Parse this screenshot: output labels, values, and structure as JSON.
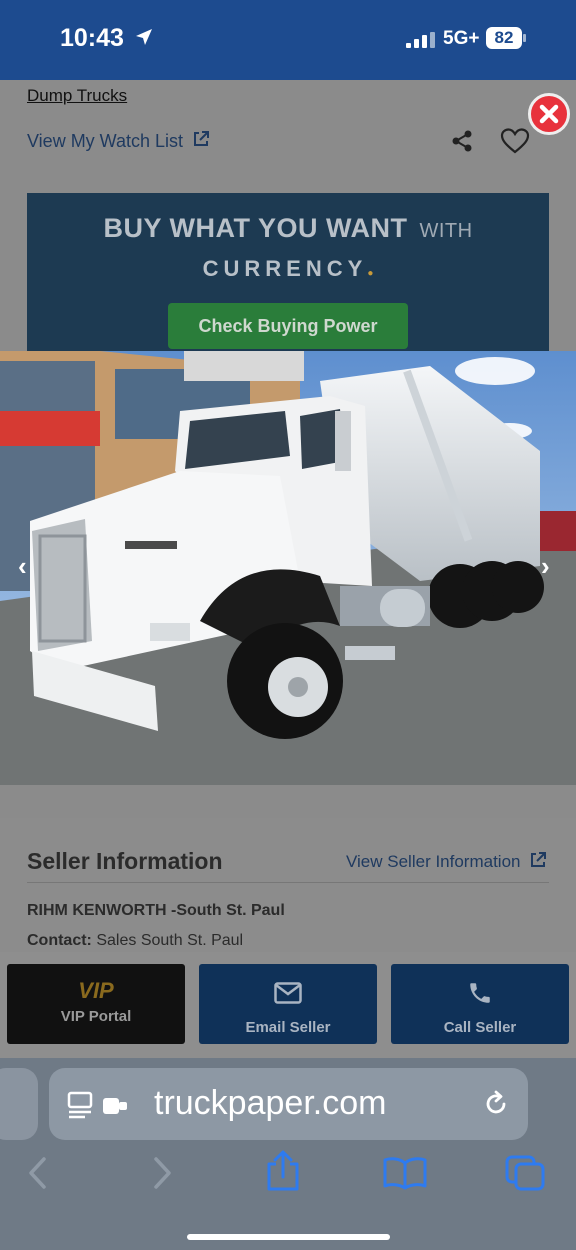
{
  "status": {
    "time": "10:43",
    "network": "5G+",
    "battery": "82"
  },
  "page": {
    "breadcrumb": "Dump Trucks",
    "watch_list": "View My Watch List"
  },
  "banner": {
    "headline": "BUY WHAT YOU WANT",
    "with": "WITH",
    "brand": "CURRENCY",
    "button": "Check Buying Power"
  },
  "seller": {
    "title": "Seller Information",
    "view_link": "View Seller Information",
    "name": "RIHM KENWORTH -South St. Paul",
    "contact_label": "Contact:",
    "contact_value": "Sales South St. Paul"
  },
  "actions": {
    "vip": "VIP Portal",
    "email": "Email Seller",
    "call": "Call Seller"
  },
  "browser": {
    "url": "truckpaper.com"
  },
  "colors": {
    "status_bar": "#1d4b8f",
    "banner": "#1d3a52",
    "cta_green": "#2a7d3a",
    "action_navy": "#0f3158",
    "close_red": "#e8323c"
  }
}
